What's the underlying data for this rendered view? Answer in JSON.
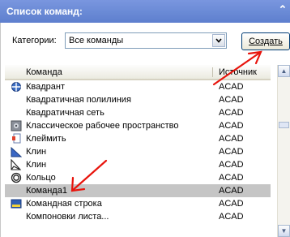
{
  "window": {
    "title": "Список команд:",
    "collapse_glyph": "⌃"
  },
  "filter": {
    "label": "Категории:",
    "selected": "Все команды"
  },
  "create_button": {
    "label": "Создать"
  },
  "columns": {
    "command": "Команда",
    "source": "Источник"
  },
  "rows": [
    {
      "name": "Квадрант",
      "source": "ACAD",
      "icon": "quadrant-icon"
    },
    {
      "name": "Квадратичная полилиния",
      "source": "ACAD",
      "icon": ""
    },
    {
      "name": "Квадратичная сеть",
      "source": "ACAD",
      "icon": ""
    },
    {
      "name": "Классическое рабочее пространство",
      "source": "ACAD",
      "icon": "workspace-icon"
    },
    {
      "name": "Клеймить",
      "source": "ACAD",
      "icon": "stamp-icon"
    },
    {
      "name": "Клин",
      "source": "ACAD",
      "icon": "wedge-solid-icon"
    },
    {
      "name": "Клин",
      "source": "ACAD",
      "icon": "wedge-wire-icon"
    },
    {
      "name": "Кольцо",
      "source": "ACAD",
      "icon": "donut-icon"
    },
    {
      "name": "Команда1",
      "source": "ACAD",
      "icon": "",
      "selected": true
    },
    {
      "name": "Командная строка",
      "source": "ACAD",
      "icon": "command-line-icon"
    },
    {
      "name": "Компоновки листа...",
      "source": "ACAD",
      "icon": ""
    }
  ],
  "colors": {
    "titlebar": "#6b8bd6",
    "selection": "#c5c5c5",
    "annotation_arrow": "#e8140c"
  }
}
